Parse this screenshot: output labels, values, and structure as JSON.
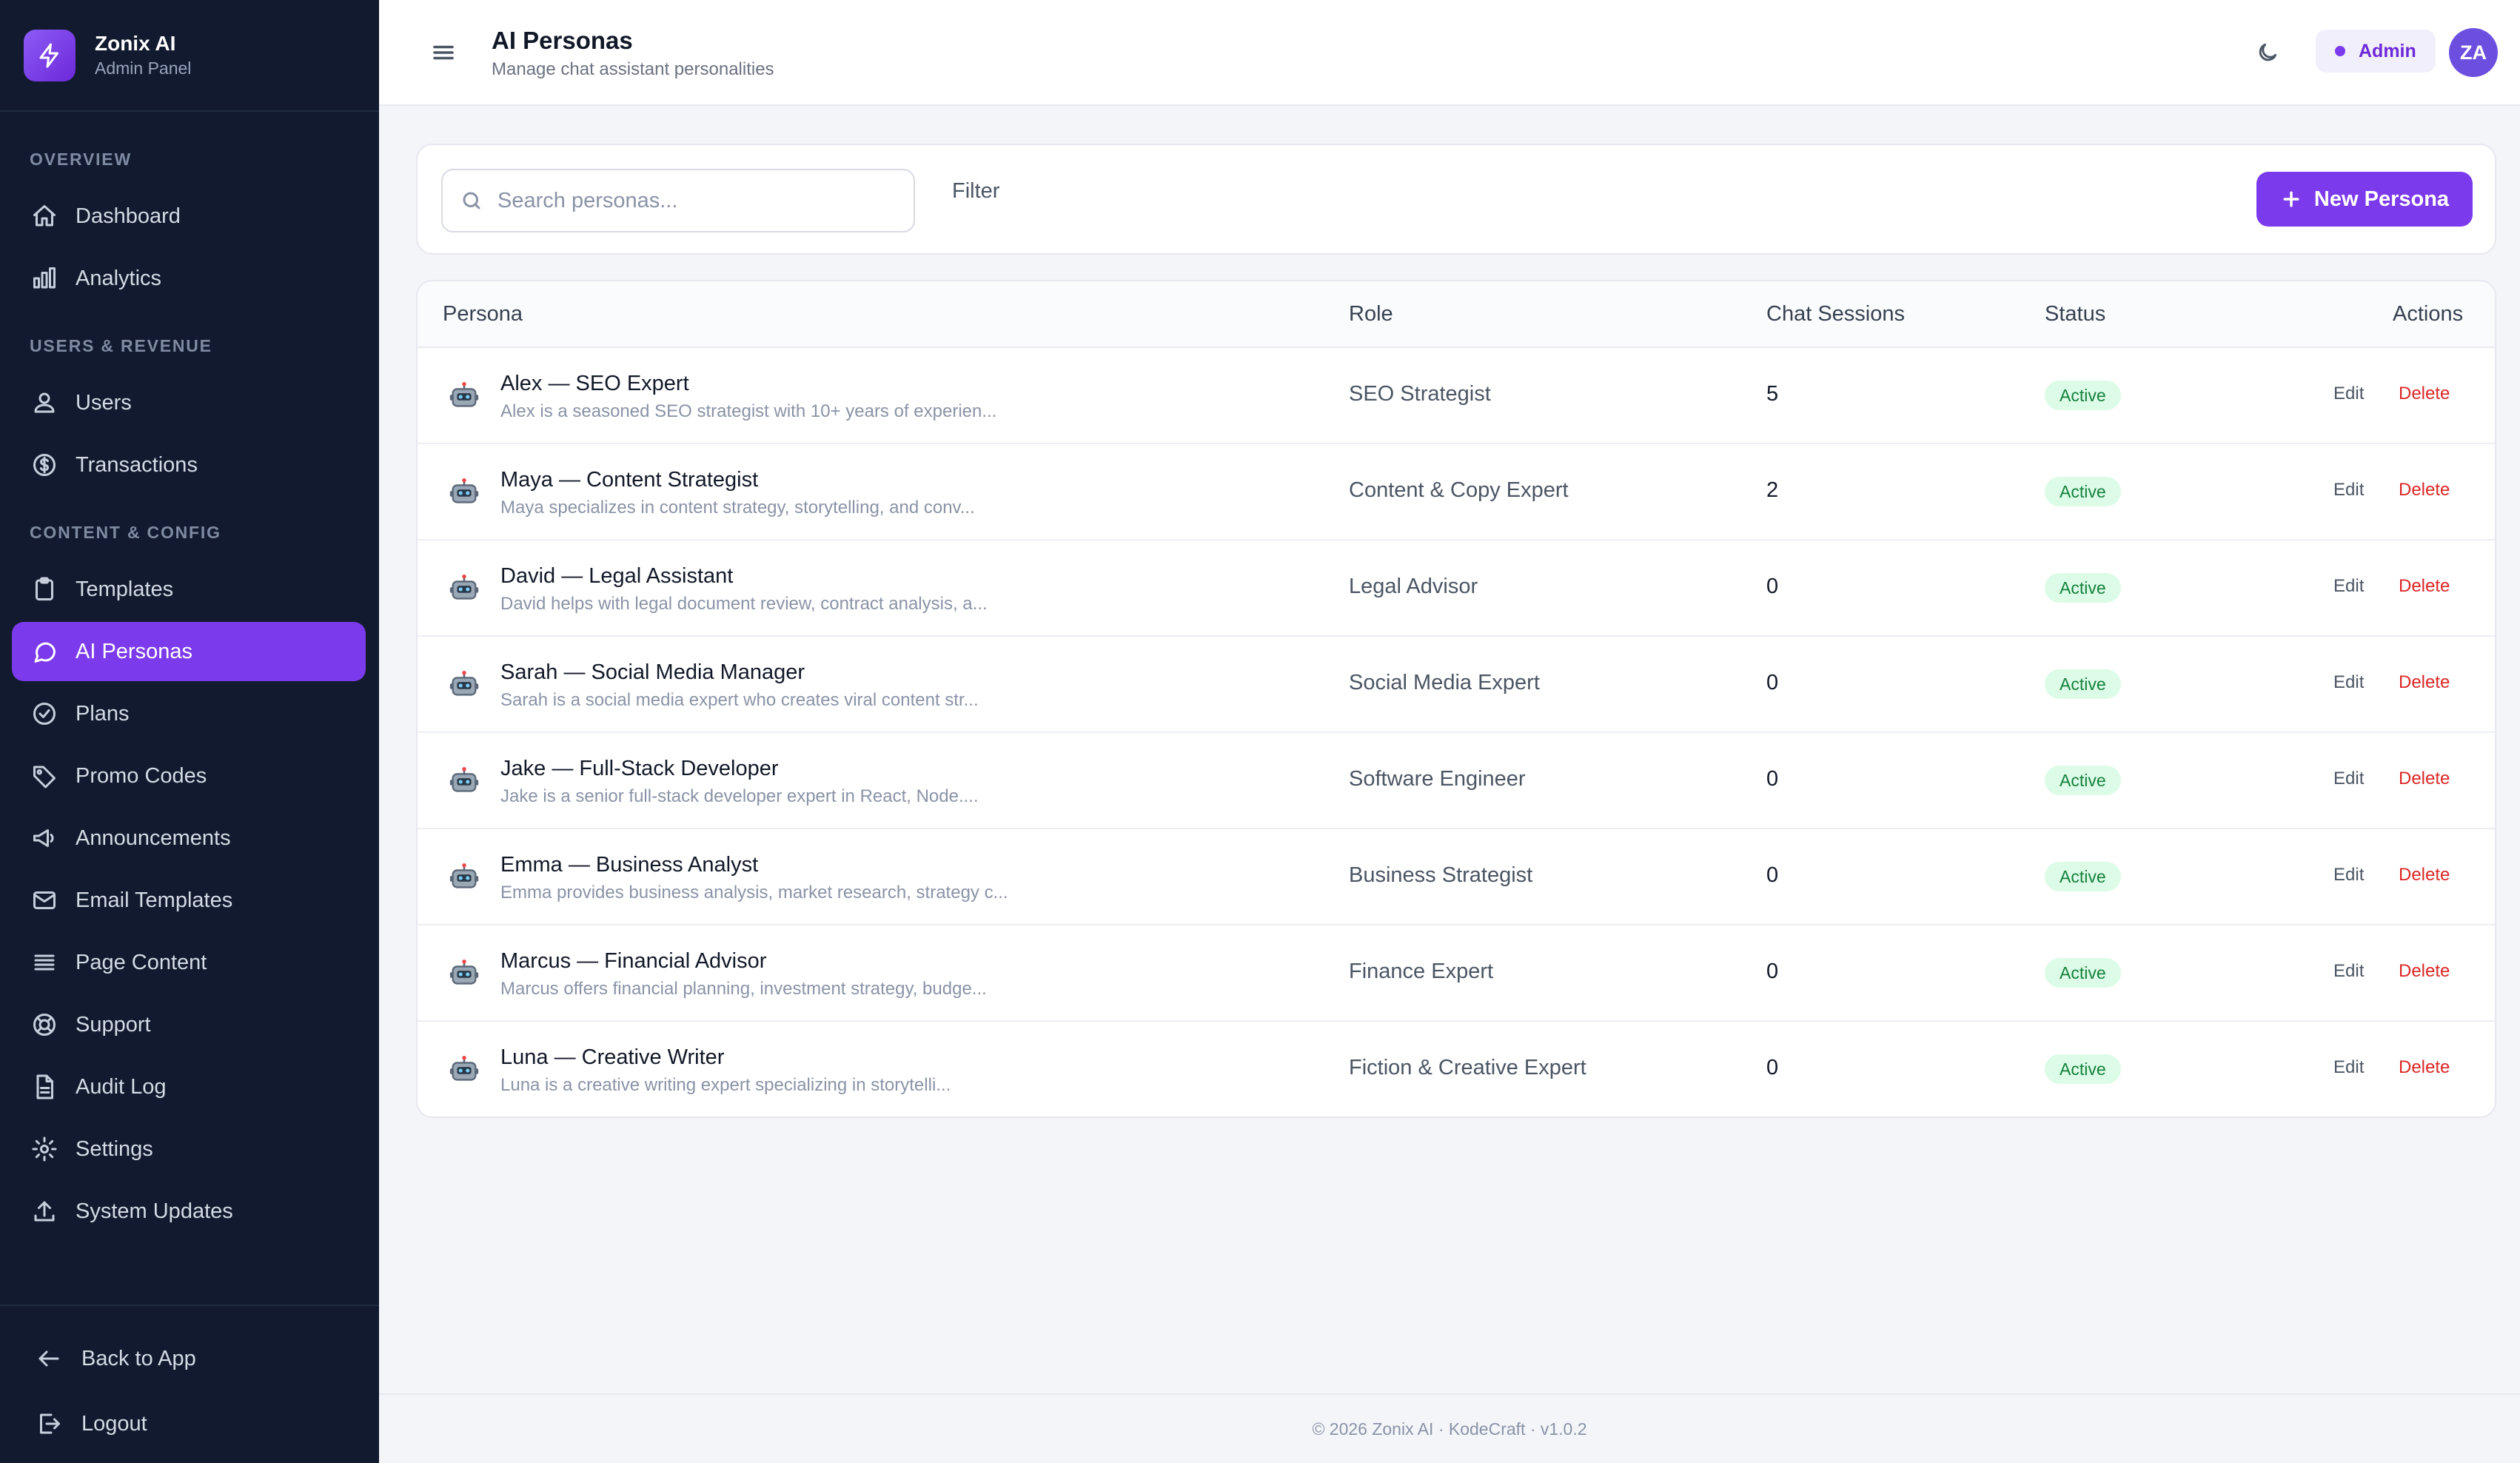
{
  "brand": {
    "title": "Zonix AI",
    "subtitle": "Admin Panel"
  },
  "sidebar": {
    "sections": [
      {
        "label": "OVERVIEW",
        "items": [
          "Dashboard",
          "Analytics"
        ]
      },
      {
        "label": "USERS & REVENUE",
        "items": [
          "Users",
          "Transactions"
        ]
      },
      {
        "label": "CONTENT & CONFIG",
        "items": [
          "Templates",
          "AI Personas",
          "Plans",
          "Promo Codes",
          "Announcements",
          "Email Templates",
          "Page Content",
          "Support",
          "Audit Log",
          "Settings",
          "System Updates"
        ]
      }
    ],
    "active_item": "AI Personas",
    "bottom": {
      "back": "Back to App",
      "logout": "Logout"
    }
  },
  "header": {
    "title": "AI Personas",
    "subtitle": "Manage chat assistant personalities",
    "role_badge": "Admin",
    "avatar_initials": "ZA"
  },
  "toolbar": {
    "search_placeholder": "Search personas...",
    "filter_label": "Filter",
    "new_button": "New Persona"
  },
  "table": {
    "columns": [
      "Persona",
      "Role",
      "Chat Sessions",
      "Status",
      "Actions"
    ],
    "edit_label": "Edit",
    "delete_label": "Delete",
    "rows": [
      {
        "name": "Alex — SEO Expert",
        "desc": "Alex is a seasoned SEO strategist with 10+ years of experien...",
        "role": "SEO Strategist",
        "sessions": "5",
        "status": "Active"
      },
      {
        "name": "Maya — Content Strategist",
        "desc": "Maya specializes in content strategy, storytelling, and conv...",
        "role": "Content & Copy Expert",
        "sessions": "2",
        "status": "Active"
      },
      {
        "name": "David — Legal Assistant",
        "desc": "David helps with legal document review, contract analysis, a...",
        "role": "Legal Advisor",
        "sessions": "0",
        "status": "Active"
      },
      {
        "name": "Sarah — Social Media Manager",
        "desc": "Sarah is a social media expert who creates viral content str...",
        "role": "Social Media Expert",
        "sessions": "0",
        "status": "Active"
      },
      {
        "name": "Jake — Full-Stack Developer",
        "desc": "Jake is a senior full-stack developer expert in React, Node....",
        "role": "Software Engineer",
        "sessions": "0",
        "status": "Active"
      },
      {
        "name": "Emma — Business Analyst",
        "desc": "Emma provides business analysis, market research, strategy c...",
        "role": "Business Strategist",
        "sessions": "0",
        "status": "Active"
      },
      {
        "name": "Marcus — Financial Advisor",
        "desc": "Marcus offers financial planning, investment strategy, budge...",
        "role": "Finance Expert",
        "sessions": "0",
        "status": "Active"
      },
      {
        "name": "Luna — Creative Writer",
        "desc": "Luna is a creative writing expert specializing in storytelli...",
        "role": "Fiction & Creative Expert",
        "sessions": "0",
        "status": "Active"
      }
    ]
  },
  "footer": {
    "text": "© 2026 Zonix AI · KodeCraft · v1.0.2"
  },
  "colors": {
    "accent": "#7c3aed",
    "sidebar_bg": "#111a2e",
    "danger": "#dc2626",
    "success_bg": "#dcfce7",
    "success_fg": "#15803d"
  }
}
